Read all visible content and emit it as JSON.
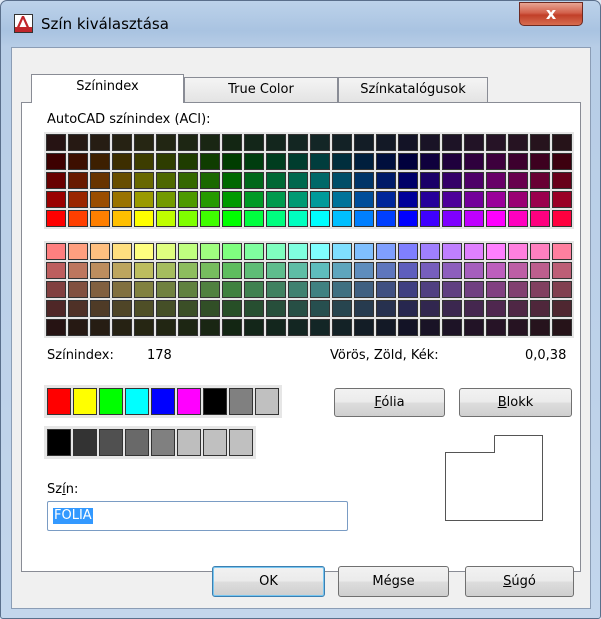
{
  "window": {
    "title": "Szín kiválasztása",
    "close_label": "x",
    "app_icon": "autocad-icon"
  },
  "tabs": [
    {
      "label": "Színindex",
      "active": true
    },
    {
      "label": "True Color",
      "active": false
    },
    {
      "label": "Színkatalógusok",
      "active": false
    }
  ],
  "aci": {
    "heading": "AutoCAD színindex (ACI):",
    "index_label": "Színindex:",
    "index_value": "178",
    "rgb_label": "Vörös, Zöld, Kék:",
    "rgb_value": "0,0,38"
  },
  "top_grid_rows": [
    [
      "#261313",
      "#261913",
      "#261d13",
      "#262213",
      "#262613",
      "#222613",
      "#1d2613",
      "#192613",
      "#132613",
      "#132619",
      "#13261d",
      "#132622",
      "#132626",
      "#132226",
      "#131d26",
      "#131926",
      "#131326",
      "#191326",
      "#1d1326",
      "#221326",
      "#261326",
      "#261322",
      "#26131d",
      "#261319"
    ],
    [
      "#3d0000",
      "#3d0f00",
      "#3d1f00",
      "#3d2e00",
      "#3d3d00",
      "#2e3d00",
      "#1f3d00",
      "#0f3d00",
      "#003d00",
      "#003d0f",
      "#003d1f",
      "#003d2e",
      "#003d3d",
      "#002e3d",
      "#001f3d",
      "#000f3d",
      "#00003d",
      "#0f003d",
      "#1f003d",
      "#2e003d",
      "#3d003d",
      "#3d002e",
      "#3d001f",
      "#3d000f"
    ],
    [
      "#680000",
      "#681a00",
      "#683400",
      "#684e00",
      "#686800",
      "#4e6800",
      "#346800",
      "#1a6800",
      "#006800",
      "#00681a",
      "#006834",
      "#00684e",
      "#006868",
      "#004e68",
      "#003468",
      "#001a68",
      "#000068",
      "#1a0068",
      "#340068",
      "#4e0068",
      "#680068",
      "#68004e",
      "#680034",
      "#68001a"
    ],
    [
      "#9a0000",
      "#9a2600",
      "#9a4d00",
      "#9a7300",
      "#9a9a00",
      "#739a00",
      "#4d9a00",
      "#269a00",
      "#009a00",
      "#009a26",
      "#009a4d",
      "#009a73",
      "#009a9a",
      "#00739a",
      "#004d9a",
      "#00269a",
      "#00009a",
      "#26009a",
      "#4d009a",
      "#73009a",
      "#9a009a",
      "#9a0073",
      "#9a004d",
      "#9a0026"
    ],
    [
      "#ff0000",
      "#ff3f00",
      "#ff7f00",
      "#ffbf00",
      "#ffff00",
      "#bfff00",
      "#7fff00",
      "#3fff00",
      "#00ff00",
      "#00ff3f",
      "#00ff7f",
      "#00ffbf",
      "#00ffff",
      "#00bfff",
      "#007fff",
      "#003fff",
      "#0000ff",
      "#3f00ff",
      "#7f00ff",
      "#bf00ff",
      "#ff00ff",
      "#ff00bf",
      "#ff007f",
      "#ff003f"
    ]
  ],
  "bottom_grid_rows": [
    [
      "#ff7f7f",
      "#ff9f7f",
      "#ffbf7f",
      "#ffdf7f",
      "#ffff7f",
      "#dfff7f",
      "#bfff7f",
      "#9fff7f",
      "#7fff7f",
      "#7fff9f",
      "#7fffbf",
      "#7fffdf",
      "#7fffff",
      "#7fdfff",
      "#7fbfff",
      "#7f9fff",
      "#7f7fff",
      "#9f7fff",
      "#bf7fff",
      "#df7fff",
      "#ff7fff",
      "#ff7fdf",
      "#ff7fbf",
      "#ff7f9f"
    ],
    [
      "#bd5e5e",
      "#bd765e",
      "#bd8d5e",
      "#bda55e",
      "#bdbd5e",
      "#a5bd5e",
      "#8dbd5e",
      "#76bd5e",
      "#5ebd5e",
      "#5ebd76",
      "#5ebd8d",
      "#5ebda5",
      "#5ebdbd",
      "#5ea5bd",
      "#5e8dbd",
      "#5e76bd",
      "#5e5ebd",
      "#765ebd",
      "#8d5ebd",
      "#a55ebd",
      "#bd5ebd",
      "#bd5ea5",
      "#bd5e8d",
      "#bd5e76"
    ],
    [
      "#814040",
      "#815040",
      "#816040",
      "#817040",
      "#818140",
      "#708140",
      "#608140",
      "#508140",
      "#408140",
      "#408150",
      "#408160",
      "#408170",
      "#408181",
      "#407081",
      "#406081",
      "#405081",
      "#404081",
      "#504081",
      "#604081",
      "#704081",
      "#814081",
      "#814070",
      "#814060",
      "#814050"
    ],
    [
      "#4f2727",
      "#4f3127",
      "#4f3b27",
      "#4f4527",
      "#4f4f27",
      "#454f27",
      "#3b4f27",
      "#314f27",
      "#274f27",
      "#274f31",
      "#274f3b",
      "#274f45",
      "#274f4f",
      "#27454f",
      "#273b4f",
      "#27314f",
      "#27274f",
      "#31274f",
      "#3b274f",
      "#45274f",
      "#4f274f",
      "#4f2745",
      "#4f273b",
      "#4f2731"
    ],
    [
      "#261313",
      "#261913",
      "#261d13",
      "#262213",
      "#262613",
      "#222613",
      "#1d2613",
      "#192613",
      "#132613",
      "#132619",
      "#13261d",
      "#132622",
      "#132626",
      "#132226",
      "#131d26",
      "#131926",
      "#131326",
      "#191326",
      "#1d1326",
      "#221326",
      "#261326",
      "#261322",
      "#26131d",
      "#261319"
    ]
  ],
  "standard_colors": [
    "#ff0000",
    "#ffff00",
    "#00ff00",
    "#00ffff",
    "#0000ff",
    "#ff00ff",
    "#000000",
    "#808080",
    "#c0c0c0"
  ],
  "gray_shades": [
    "#000000",
    "#333333",
    "#505050",
    "#696969",
    "#808080",
    "#bebebe",
    "#c0c0c0",
    "#c0c0c0"
  ],
  "buttons": {
    "folia": {
      "pre": "",
      "u": "F",
      "post": "ólia"
    },
    "blokk": {
      "pre": "",
      "u": "B",
      "post": "lokk"
    },
    "ok": "OK",
    "cancel": "Mégse",
    "help": {
      "pre": "",
      "u": "S",
      "post": "úgó"
    }
  },
  "color_field": {
    "label_pre": "Sz",
    "label_u": "í",
    "label_post": "n:",
    "value": "FÓLIA"
  }
}
